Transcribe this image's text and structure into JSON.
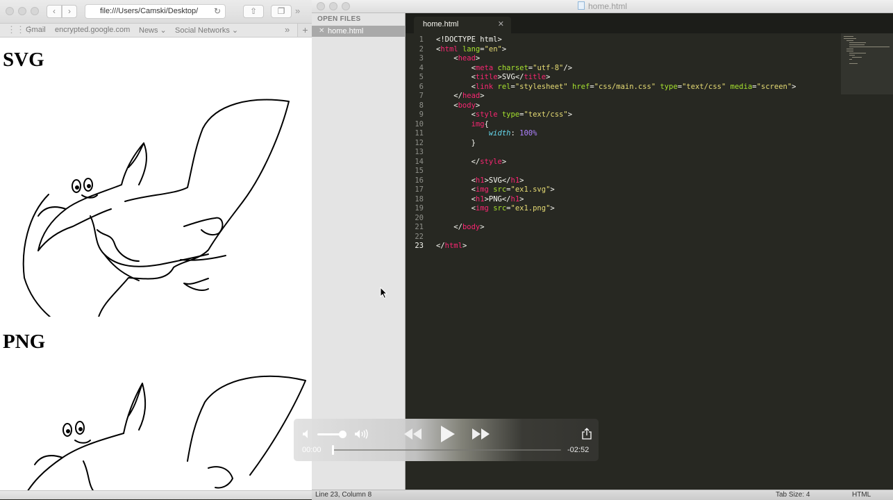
{
  "safari": {
    "url": "file:///Users/Camski/Desktop/",
    "bookmarks": [
      "Gmail",
      "encrypted.google.com",
      "News ⌄",
      "Social Networks ⌄"
    ],
    "page": {
      "heading_svg": "SVG",
      "heading_png": "PNG"
    }
  },
  "sublime": {
    "window_title": "home.html",
    "sidebar_header": "OPEN FILES",
    "sidebar_file": "home.html",
    "tab_label": "home.html",
    "line_numbers": [
      "1",
      "2",
      "3",
      "4",
      "5",
      "6",
      "7",
      "8",
      "9",
      "10",
      "11",
      "12",
      "13",
      "14",
      "15",
      "16",
      "17",
      "18",
      "19",
      "20",
      "21",
      "22",
      "23"
    ],
    "code": {
      "l1": "<!DOCTYPE html>",
      "l2_lang": "\"en\"",
      "l4_charset": "\"utf-8\"",
      "l5_title": "SVG",
      "l6_rel": "\"stylesheet\"",
      "l6_href": "\"css/main.css\"",
      "l6_type": "\"text/css\"",
      "l6_media": "\"screen\"",
      "l9_type": "\"text/css\"",
      "l10_sel": "img",
      "l11_prop": "width",
      "l11_val": "100%",
      "l16_text": "SVG",
      "l17_src": "\"ex1.svg\"",
      "l18_text": "PNG",
      "l19_src": "\"ex1.png\""
    },
    "status": {
      "position": "Line 23, Column 8",
      "tab_size": "Tab Size: 4",
      "syntax": "HTML"
    }
  },
  "player": {
    "current_time": "00:00",
    "remaining_time": "-02:52",
    "volume_level": 0.85,
    "progress": 0.0
  },
  "colors": {
    "editor_bg": "#272822",
    "tag": "#f92672",
    "attr": "#a6e22e",
    "string": "#e6db74",
    "property": "#66d9ef",
    "number": "#ae81ff"
  }
}
